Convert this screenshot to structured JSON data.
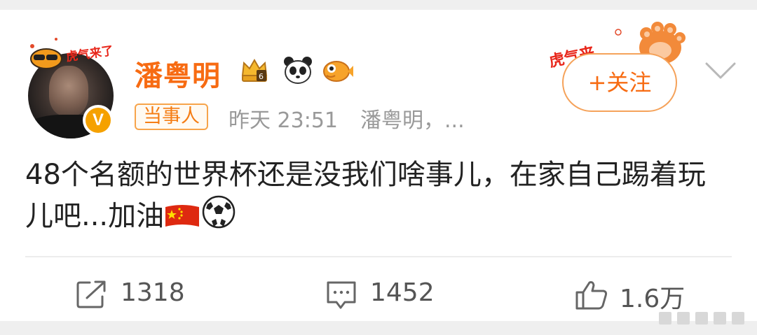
{
  "user": {
    "name": "潘粤明",
    "avatar_sticker_text": "虎气来了",
    "verified_mark": "V",
    "tag": "当事人"
  },
  "meta": {
    "time": "昨天 23:51",
    "source": "潘粤明，..."
  },
  "follow": {
    "label": "+关注",
    "deco_text": "虎气来了"
  },
  "post": {
    "text": "48个名额的世界杯还是没我们啥事儿，在家自己踢着玩儿吧...加油",
    "emojis": [
      "china-flag-icon",
      "soccer-ball-icon"
    ]
  },
  "actions": {
    "repost_count": "1318",
    "comment_count": "1452",
    "like_count": "1.6万"
  },
  "colors": {
    "name": "#f76b12",
    "tag_border": "#f7a44a",
    "meta": "#999999",
    "body_text": "#222222",
    "page_bg": "#efefef"
  }
}
